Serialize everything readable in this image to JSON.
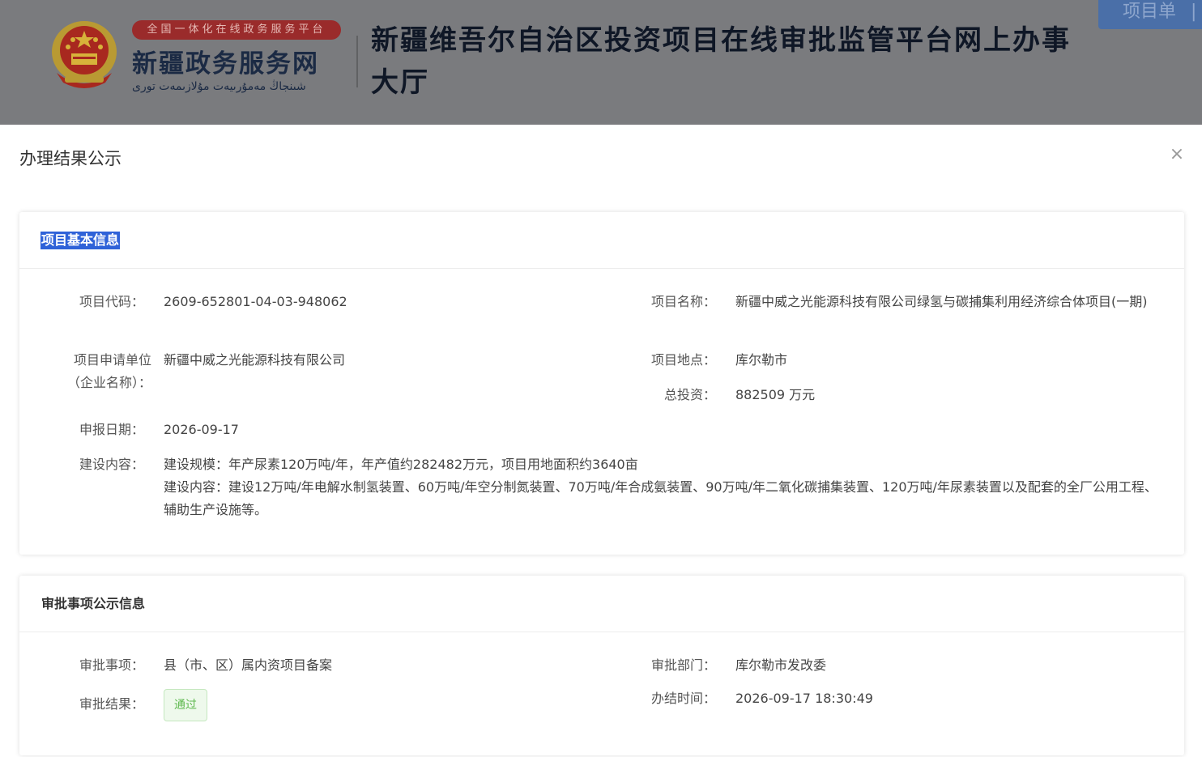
{
  "header": {
    "platform_tag": "全国一体化在线政务服务平台",
    "brand_name": "新疆政务服务网",
    "brand_sub": "شىنجاڭ مەمۇرىيەت مۇلازىمەت تورى",
    "site_title": "新疆维吾尔自治区投资项目在线审批监管平台网上办事大厅",
    "project_tab_label": "项目单",
    "project_tab_sep": "|"
  },
  "modal": {
    "title": "办理结果公示",
    "close_label": "×",
    "basic_info": {
      "title": "项目基本信息",
      "project_code_label": "项目代码：",
      "project_code": "2609-652801-04-03-948062",
      "project_name_label": "项目名称：",
      "project_name": "新疆中威之光能源科技有限公司绿氢与碳捕集利用经济综合体项目(一期)",
      "applicant_label_1": "项目申请单位",
      "applicant_label_2": "（企业名称）：",
      "applicant": "新疆中威之光能源科技有限公司",
      "location_label": "项目地点：",
      "location": "库尔勒市",
      "investment_label": "总投资：",
      "investment": "882509 万元",
      "report_date_label": "申报日期：",
      "report_date": "2026-09-17",
      "content_label": "建设内容：",
      "content_line_1": "建设规模：年产尿素120万吨/年，年产值约282482万元，项目用地面积约3640亩",
      "content_line_2": "建设内容：建设12万吨/年电解水制氢装置、60万吨/年空分制氮装置、70万吨/年合成氨装置、90万吨/年二氧化碳捕集装置、120万吨/年尿素装置以及配套的全厂公用工程、辅助生产设施等。"
    },
    "approval_info": {
      "title": "审批事项公示信息",
      "item_label": "审批事项：",
      "item": "县（市、区）属内资项目备案",
      "dept_label": "审批部门：",
      "dept": "库尔勒市发改委",
      "result_label": "审批结果：",
      "result": "通过",
      "time_label": "办结时间：",
      "time": "2026-09-17 18:30:49"
    }
  },
  "colors": {
    "overlay": "#7a7b7e",
    "selection_highlight": "#2f62d8",
    "badge_green": "#5fb94f",
    "emblem_red": "#c8281e",
    "emblem_gold": "#f2c230"
  }
}
